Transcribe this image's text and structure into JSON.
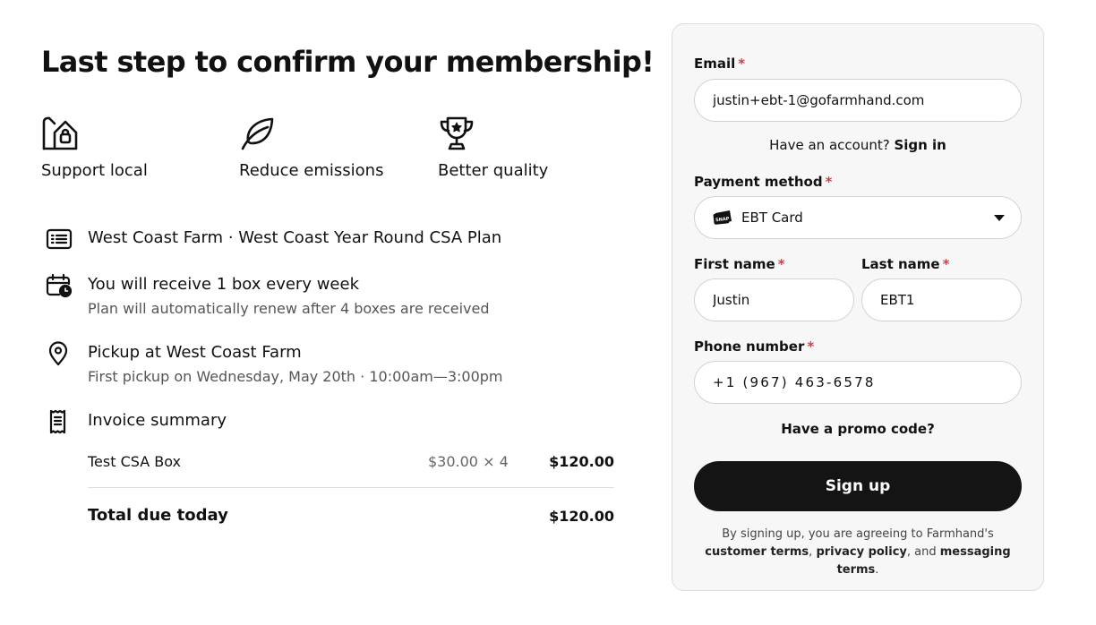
{
  "page": {
    "title": "Last step to confirm your membership!"
  },
  "benefits": [
    {
      "icon": "farm-building-icon",
      "label": "Support local"
    },
    {
      "icon": "leaf-icon",
      "label": "Reduce emissions"
    },
    {
      "icon": "trophy-icon",
      "label": "Better quality"
    }
  ],
  "plan": {
    "icon": "list-icon",
    "farm": "West Coast Farm",
    "separator": " · ",
    "name": "West Coast Year Round CSA Plan"
  },
  "schedule": {
    "icon": "calendar-clock-icon",
    "main": "You will receive 1 box every week",
    "sub": "Plan will automatically renew after 4 boxes are received"
  },
  "pickup": {
    "icon": "location-pin-icon",
    "main": "Pickup at West Coast Farm",
    "sub": "First pickup on Wednesday, May 20th · 10:00am—3:00pm"
  },
  "invoice": {
    "icon": "receipt-icon",
    "title": "Invoice summary",
    "items": [
      {
        "name": "Test CSA Box",
        "qty": "$30.00 × 4",
        "price": "$120.00"
      }
    ],
    "total_label": "Total due today",
    "total_value": "$120.00"
  },
  "form": {
    "email_label": "Email",
    "email_value": "justin+ebt-1@gofarmhand.com",
    "required_mark": "*",
    "account_prompt": "Have an account?",
    "sign_in": "Sign in",
    "payment_label": "Payment method",
    "payment_value": "EBT Card",
    "payment_icon": "snap-card-icon",
    "first_name_label": "First name",
    "first_name_value": "Justin",
    "last_name_label": "Last name",
    "last_name_value": "EBT1",
    "phone_label": "Phone number",
    "phone_value": "+1 (967) 463-6578",
    "promo": "Have a promo code?",
    "signup_button": "Sign up",
    "legal_prefix": "By signing up, you are agreeing to Farmhand's",
    "legal_customer_terms": "customer terms",
    "legal_sep1": ", ",
    "legal_privacy": "privacy policy",
    "legal_sep2": ", and ",
    "legal_messaging": "messaging terms",
    "legal_end": "."
  },
  "colors": {
    "required": "#e0393e",
    "button_bg": "#141414",
    "panel_bg": "#f7f7f7"
  }
}
